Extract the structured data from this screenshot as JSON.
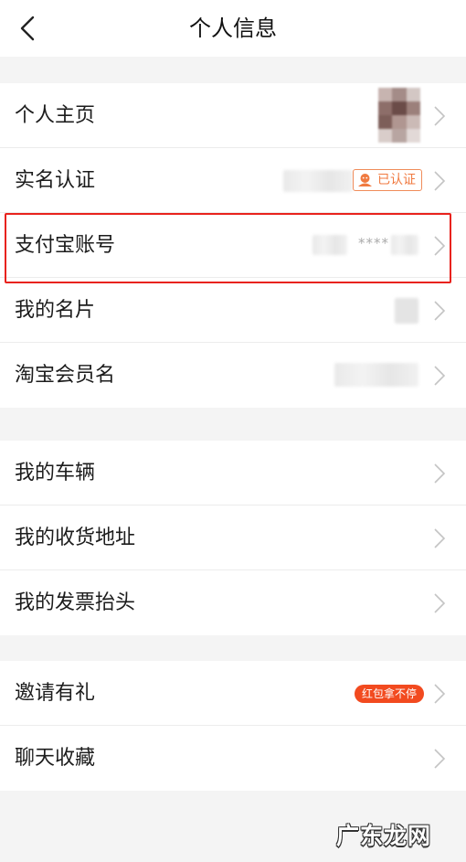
{
  "header": {
    "title": "个人信息",
    "back_icon": "chevron-left-icon"
  },
  "group1": [
    {
      "id": "homepage",
      "label": "个人主页"
    },
    {
      "id": "realname",
      "label": "实名认证",
      "badge": "已认证"
    },
    {
      "id": "alipay",
      "label": "支付宝账号",
      "masked": "****"
    },
    {
      "id": "card",
      "label": "我的名片"
    },
    {
      "id": "taobao",
      "label": "淘宝会员名"
    }
  ],
  "group2": [
    {
      "id": "vehicle",
      "label": "我的车辆"
    },
    {
      "id": "address",
      "label": "我的收货地址"
    },
    {
      "id": "invoice",
      "label": "我的发票抬头"
    }
  ],
  "group3": [
    {
      "id": "invite",
      "label": "邀请有礼",
      "badge": "红包拿不停"
    },
    {
      "id": "chat",
      "label": "聊天收藏"
    }
  ],
  "watermark": "广东龙网",
  "colors": {
    "accent": "#f24a1f",
    "highlight": "#e8221c",
    "verified": "#f07a40"
  }
}
